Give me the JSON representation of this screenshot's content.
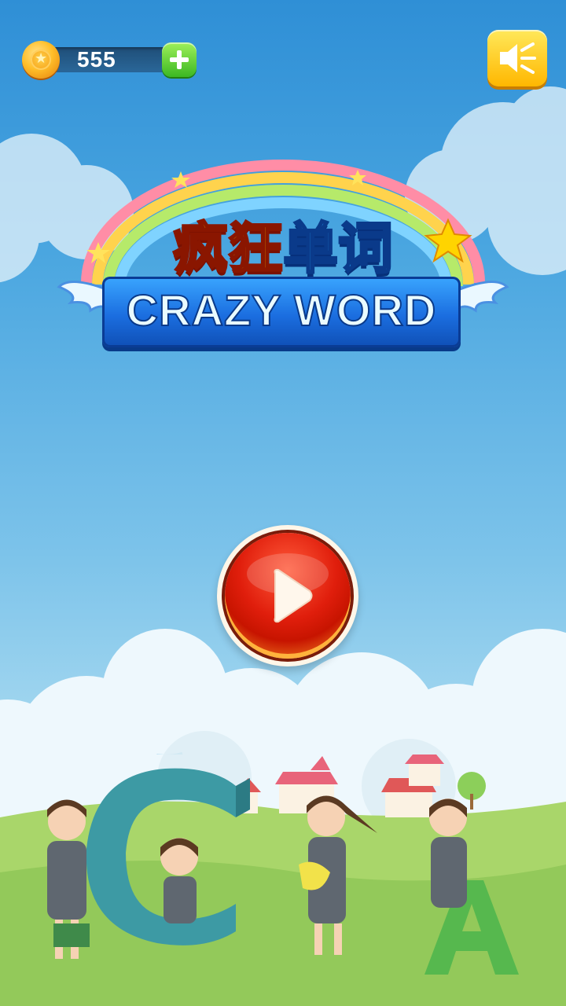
{
  "hud": {
    "coins": "555",
    "coin_icon": "coin-icon",
    "add_icon": "plus-icon",
    "sound_icon": "speaker-icon"
  },
  "logo": {
    "title_cn_part1": "疯狂",
    "title_cn_part2": "单词",
    "title_en": "CRAZY WORD"
  },
  "play": {
    "icon": "play-icon"
  },
  "colors": {
    "sky_top": "#2f8fd6",
    "sky_bottom": "#bfe6f3",
    "play_red": "#e01e0c",
    "coin_gold": "#ffbf2a",
    "sound_yellow": "#ffd000",
    "add_green": "#3cb823"
  }
}
